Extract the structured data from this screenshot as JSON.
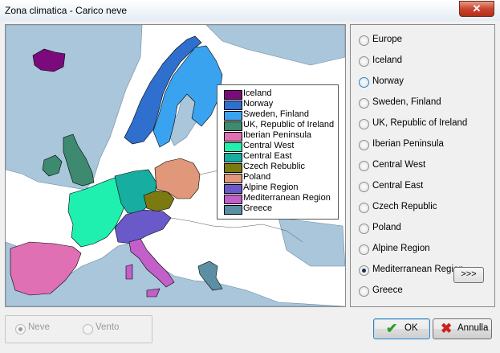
{
  "window": {
    "title": "Zona climatica - Carico neve",
    "close_glyph": "✕"
  },
  "regions": {
    "options": [
      "Europe",
      "Iceland",
      "Norway",
      "Sweden, Finland",
      "UK, Republic of Ireland",
      "Iberian Peninsula",
      "Central West",
      "Central East",
      "Czech Republic",
      "Poland",
      "Alpine Region",
      "Mediterranean Region",
      "Greece"
    ],
    "selected": "Mediterranean Region",
    "hovered": "Norway",
    "more_button": ">>>"
  },
  "legend": {
    "items": [
      {
        "label": "Iceland",
        "color": "#7b0a7c"
      },
      {
        "label": "Norway",
        "color": "#2f6fce"
      },
      {
        "label": "Sweden, Finland",
        "color": "#3aa3f0"
      },
      {
        "label": "UK, Republic of Ireland",
        "color": "#3d8a70"
      },
      {
        "label": "Iberian Peninsula",
        "color": "#e070b4"
      },
      {
        "label": "Central West",
        "color": "#1ff0b0"
      },
      {
        "label": "Central East",
        "color": "#17aea1"
      },
      {
        "label": "Czech Rebublic",
        "color": "#7a7a10"
      },
      {
        "label": "Poland",
        "color": "#e0977a"
      },
      {
        "label": "Alpine Region",
        "color": "#6a59c9"
      },
      {
        "label": "Mediterranean Region",
        "color": "#c35fc8"
      },
      {
        "label": "Greece",
        "color": "#5b8fa4"
      }
    ]
  },
  "map": {
    "sea_color": "#a9c6db",
    "land_color": "#ffffff"
  },
  "load_type": {
    "options": [
      "Neve",
      "Vento"
    ],
    "selected": "Neve"
  },
  "buttons": {
    "ok_label": "OK",
    "ok_icon": "check-icon",
    "cancel_label": "Annulla",
    "cancel_icon": "x-icon"
  }
}
